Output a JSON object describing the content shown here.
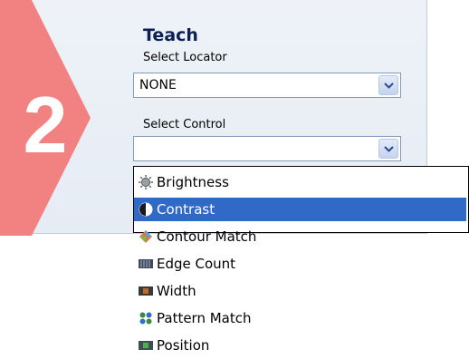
{
  "step": {
    "number": "2",
    "title": "Teach"
  },
  "locator": {
    "label": "Select Locator",
    "value": "NONE"
  },
  "control": {
    "label": "Select Control",
    "value": ""
  },
  "dropdown": {
    "items": [
      {
        "label": "Brightness",
        "icon": "brightness-icon"
      },
      {
        "label": "Contrast",
        "icon": "contrast-icon",
        "selected": true
      },
      {
        "label": "Contour Match",
        "icon": "contour-match-icon"
      },
      {
        "label": "Edge Count",
        "icon": "edge-count-icon"
      },
      {
        "label": "Width",
        "icon": "width-icon"
      },
      {
        "label": "Pattern Match",
        "icon": "pattern-match-icon"
      },
      {
        "label": "Position",
        "icon": "position-icon"
      }
    ]
  },
  "colors": {
    "step_arrow": "#f28282",
    "selection": "#3169c6",
    "title": "#0a1f55"
  }
}
